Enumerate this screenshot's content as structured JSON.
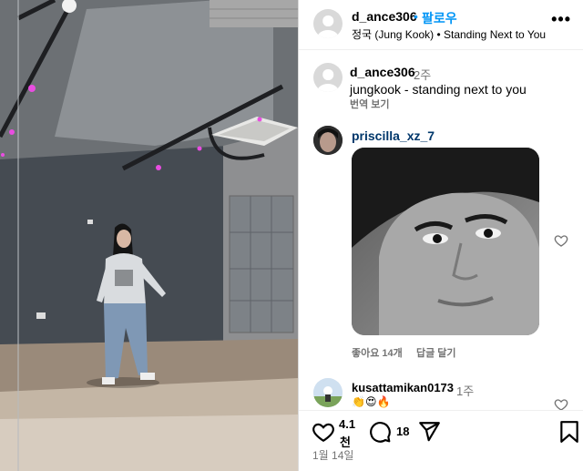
{
  "post": {
    "author": "d_ance306",
    "separator": "•",
    "follow_label": "팔로우",
    "audio": "정국 (Jung Kook) • Standing Next to You",
    "more_label": "•••"
  },
  "caption": {
    "username": "d_ance306",
    "time": "2주",
    "text": "jungkook - standing next to you",
    "translate_label": "번역 보기"
  },
  "comments": [
    {
      "username": "priscilla_xz_7",
      "likes_label": "좋아요 14개",
      "reply_label": "답글 달기"
    },
    {
      "username": "kusattamikan0173",
      "time": "1주",
      "emojis": "👏😍🔥"
    }
  ],
  "action_bar": {
    "like_count_line1": "4.1",
    "like_count_line2": "천",
    "comment_count": "18",
    "date": "1월 14일"
  },
  "colors": {
    "link_blue": "#0095f6",
    "muted_text": "#737373",
    "stage_light": "#e94de1"
  },
  "icons": [
    "more-icon",
    "heart-icon",
    "comment-icon",
    "share-icon",
    "bookmark-icon"
  ]
}
